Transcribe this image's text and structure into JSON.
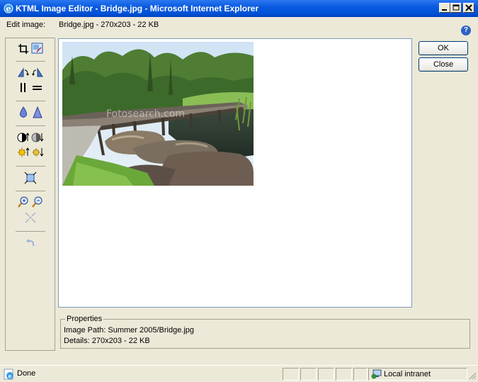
{
  "window": {
    "title": "KTML Image Editor - Bridge.jpg - Microsoft Internet Explorer",
    "minimize_icon": "minimize-icon",
    "maximize_icon": "maximize-icon",
    "close_icon": "close-icon"
  },
  "header": {
    "edit_image_label": "Edit image:",
    "file_info": "Bridge.jpg - 270x203 - 22 KB",
    "help_glyph": "?"
  },
  "tools": [
    {
      "name": "crop",
      "icon": "crop-icon"
    },
    {
      "name": "resize",
      "icon": "resize-icon"
    },
    {
      "name": "rotate-left",
      "icon": "rotate-left-icon"
    },
    {
      "name": "rotate-right",
      "icon": "rotate-right-icon"
    },
    {
      "name": "flip-vertical",
      "icon": "flip-vertical-icon"
    },
    {
      "name": "flip-horizontal",
      "icon": "flip-horizontal-icon"
    },
    {
      "name": "blur",
      "icon": "blur-icon"
    },
    {
      "name": "sharpen",
      "icon": "sharpen-icon"
    },
    {
      "name": "contrast-up",
      "icon": "contrast-up-icon"
    },
    {
      "name": "contrast-down",
      "icon": "contrast-down-icon"
    },
    {
      "name": "brightness-up",
      "icon": "brightness-up-icon"
    },
    {
      "name": "brightness-down",
      "icon": "brightness-down-icon"
    },
    {
      "name": "fit",
      "icon": "fit-to-window-icon"
    },
    {
      "name": "zoom-in",
      "icon": "zoom-in-icon"
    },
    {
      "name": "zoom-out",
      "icon": "zoom-out-icon"
    },
    {
      "name": "actual-size",
      "icon": "actual-size-icon"
    },
    {
      "name": "undo",
      "icon": "undo-icon"
    }
  ],
  "buttons": {
    "ok": "OK",
    "close": "Close"
  },
  "image": {
    "watermark": "Fotosearch.com"
  },
  "properties": {
    "legend": "Properties",
    "image_path": "Image Path: Summer 2005/Bridge.jpg",
    "details": "Details: 270x203 - 22 KB"
  },
  "status": {
    "text": "Done",
    "zone": "Local intranet"
  }
}
